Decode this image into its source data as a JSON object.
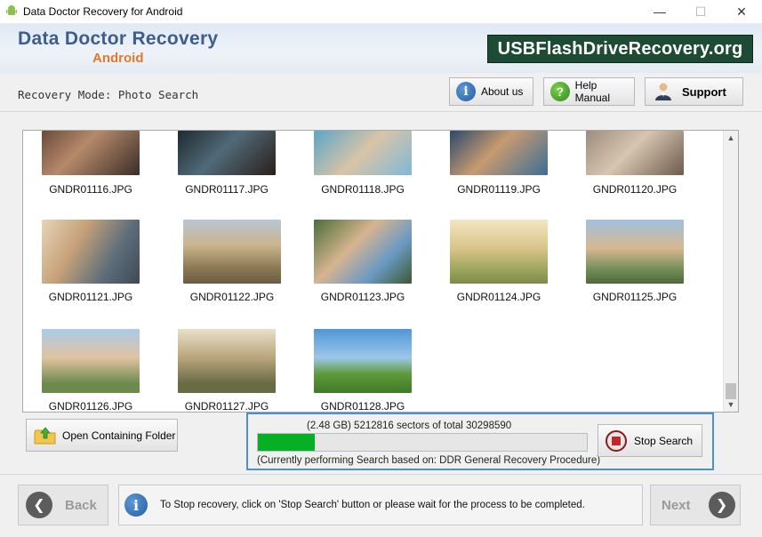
{
  "window": {
    "title": "Data Doctor Recovery for Android",
    "minimize": "—",
    "maximize": "☐",
    "close": "✕"
  },
  "header": {
    "brand_line1": "Data Doctor Recovery",
    "brand_line2": "Android",
    "site": "USBFlashDriveRecovery.org"
  },
  "toolbar": {
    "mode": "Recovery Mode: Photo Search",
    "about": "About us",
    "help": "Help Manual",
    "support": "Support"
  },
  "gallery": {
    "rows": [
      [
        "GNDR01116.JPG",
        "GNDR01117.JPG",
        "GNDR01118.JPG",
        "GNDR01119.JPG",
        "GNDR01120.JPG"
      ],
      [
        "GNDR01121.JPG",
        "GNDR01122.JPG",
        "GNDR01123.JPG",
        "GNDR01124.JPG",
        "GNDR01125.JPG"
      ],
      [
        "GNDR01126.JPG",
        "GNDR01127.JPG",
        "GNDR01128.JPG"
      ]
    ]
  },
  "actions": {
    "open_folder": "Open Containing Folder"
  },
  "progress": {
    "status": "(2.48 GB) 5212816  sectors  of  total 30298590",
    "fraction": 0.172,
    "note": "(Currently performing Search based on:  DDR General Recovery Procedure)",
    "stop": "Stop Search"
  },
  "footer": {
    "back": "Back",
    "next": "Next",
    "info": "To Stop recovery, click on 'Stop Search' button or please wait for the process to be completed."
  },
  "colors": {
    "progress_fill": "#06b025",
    "site_badge": "#1d4b34",
    "highlight_border": "#4a90d9"
  }
}
